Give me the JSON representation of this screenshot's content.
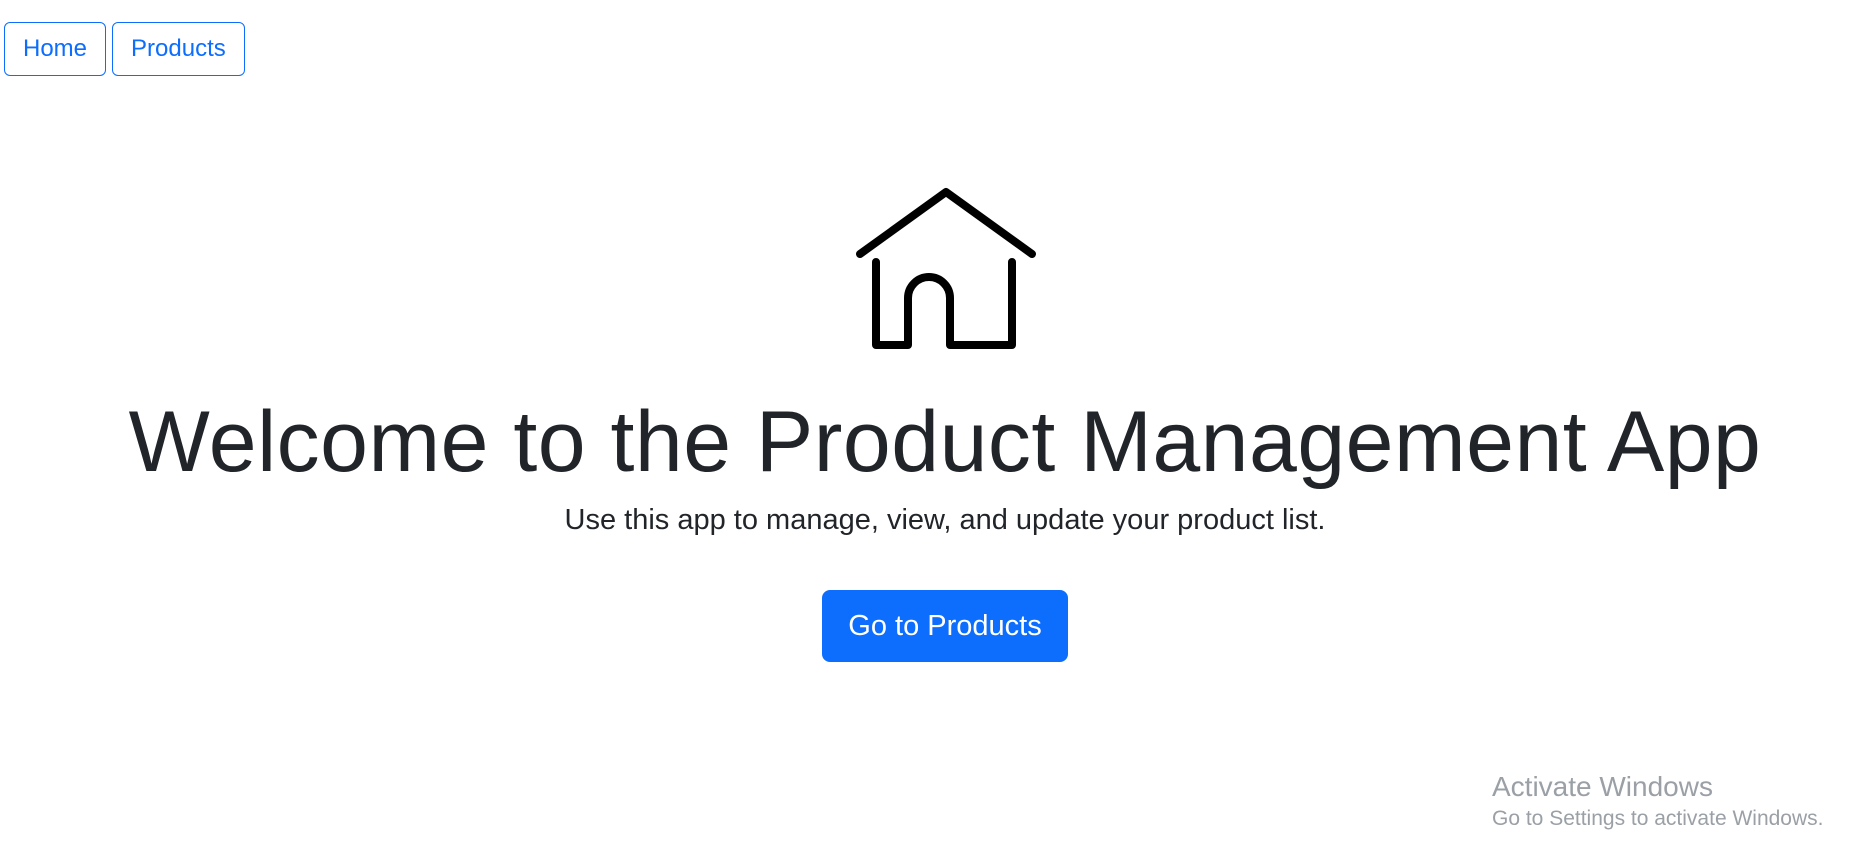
{
  "nav": {
    "items": [
      {
        "label": "Home"
      },
      {
        "label": "Products"
      }
    ]
  },
  "hero": {
    "icon": "home-icon",
    "title": "Welcome to the Product Management App",
    "subtitle": "Use this app to manage, view, and update your product list.",
    "cta_label": "Go to Products"
  },
  "watermark": {
    "title": "Activate Windows",
    "subtitle": "Go to Settings to activate Windows."
  },
  "colors": {
    "primary": "#0d6efd",
    "text": "#212529",
    "watermark": "#9aa0a6",
    "background": "#ffffff"
  }
}
